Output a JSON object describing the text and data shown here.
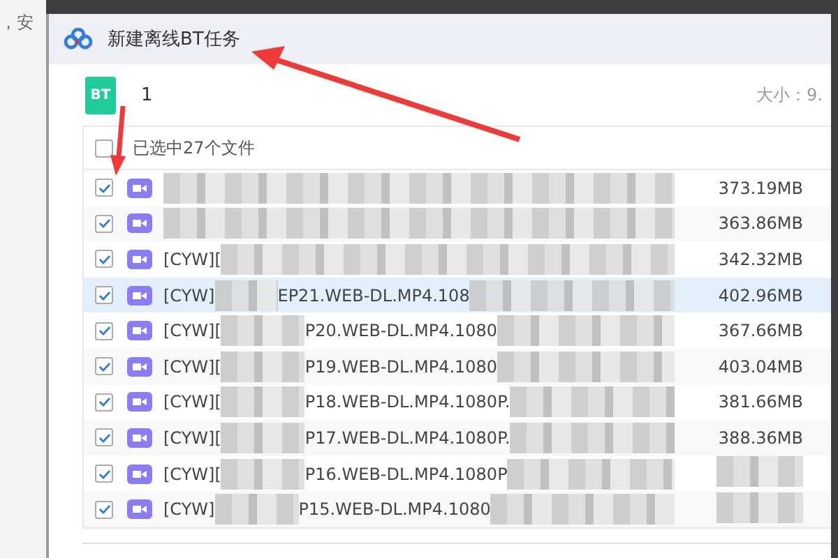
{
  "background_page": {
    "text": "，安"
  },
  "window": {
    "title": "新建离线BT任务"
  },
  "torrent": {
    "badge": "BT",
    "name": "1",
    "size_label": "大小：9."
  },
  "file_list": {
    "header": {
      "label": "已选中27个文件",
      "checked": false
    },
    "rows": [
      {
        "prefix": "",
        "suffix": "",
        "size": "373.19MB",
        "checked": true,
        "selected": false
      },
      {
        "prefix": "",
        "suffix": "",
        "size": "363.86MB",
        "checked": true,
        "selected": false
      },
      {
        "prefix": "[CYW][",
        "suffix": "",
        "size": "342.32MB",
        "checked": true,
        "selected": false
      },
      {
        "prefix": "[CYW]",
        "suffix": "EP21.WEB-DL.MP4.108",
        "size": "402.96MB",
        "checked": true,
        "selected": true
      },
      {
        "prefix": "[CYW][",
        "suffix": "P20.WEB-DL.MP4.1080",
        "size": "367.66MB",
        "checked": true,
        "selected": false
      },
      {
        "prefix": "[CYW][",
        "suffix": "P19.WEB-DL.MP4.1080",
        "size": "403.04MB",
        "checked": true,
        "selected": false
      },
      {
        "prefix": "[CYW][",
        "suffix": "P18.WEB-DL.MP4.1080P.",
        "size": "381.66MB",
        "checked": true,
        "selected": false
      },
      {
        "prefix": "[CYW][",
        "suffix": "P17.WEB-DL.MP4.1080P.",
        "size": "388.36MB",
        "checked": true,
        "selected": false
      },
      {
        "prefix": "[CYW][",
        "suffix": "P16.WEB-DL.MP4.1080P",
        "size": "",
        "checked": true,
        "selected": false
      },
      {
        "prefix": "[CYW]",
        "suffix": "P15.WEB-DL.MP4.1080",
        "size": "",
        "checked": true,
        "selected": false
      }
    ]
  }
}
